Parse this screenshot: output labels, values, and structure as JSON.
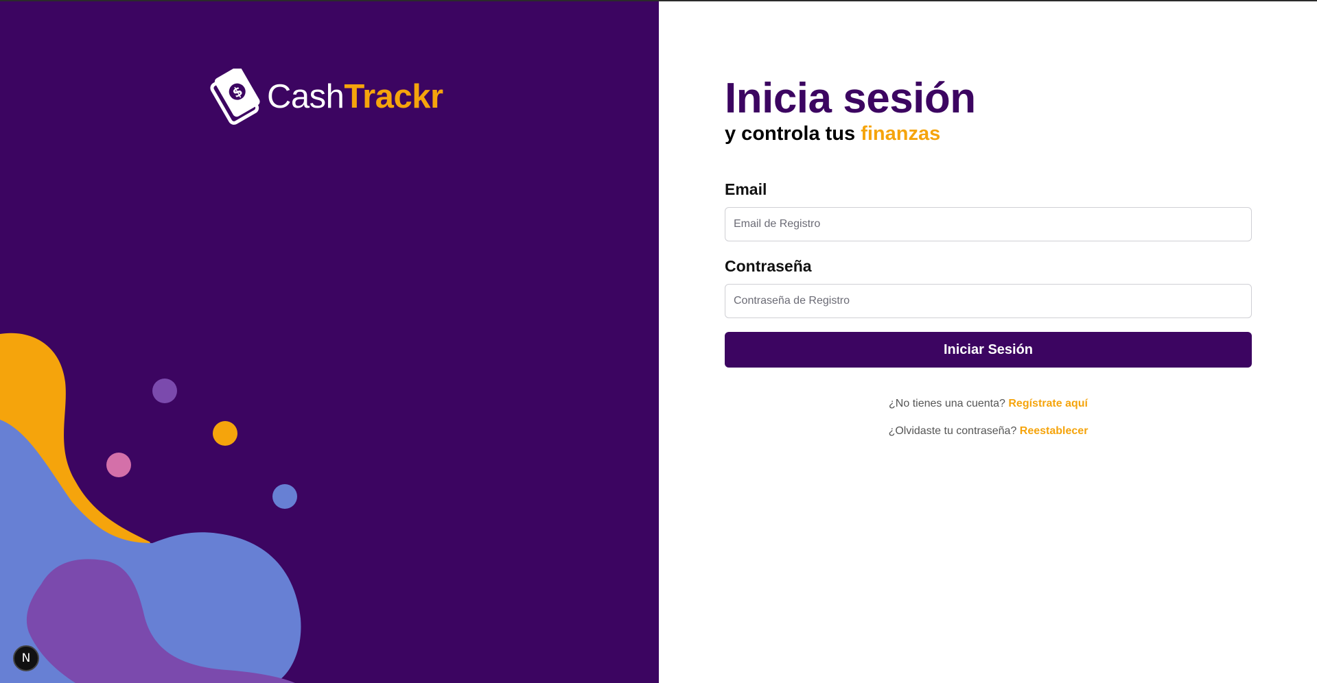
{
  "brand": {
    "logo_icon": "money-bill-icon",
    "name_part1": "Cash",
    "name_part2": "Trackr",
    "colors": {
      "primary": "#3c0561",
      "accent": "#f5a40c",
      "blue": "#6780d4",
      "violet": "#7b4aad",
      "pink": "#d470a9"
    }
  },
  "login": {
    "title": "Inicia sesión",
    "subtitle_prefix": "y controla tus ",
    "subtitle_accent": "finanzas",
    "email_label": "Email",
    "email_placeholder": "Email de Registro",
    "email_value": "",
    "password_label": "Contraseña",
    "password_placeholder": "Contraseña de Registro",
    "password_value": "",
    "submit_label": "Iniciar Sesión"
  },
  "links": {
    "register_prompt": "¿No tienes una cuenta?",
    "register_link": "Regístrate aquí",
    "reset_prompt": "¿Olvidaste tu contraseña?",
    "reset_link": "Reestablecer"
  },
  "dev_badge": {
    "letter": "N",
    "icon": "nextjs-icon"
  }
}
